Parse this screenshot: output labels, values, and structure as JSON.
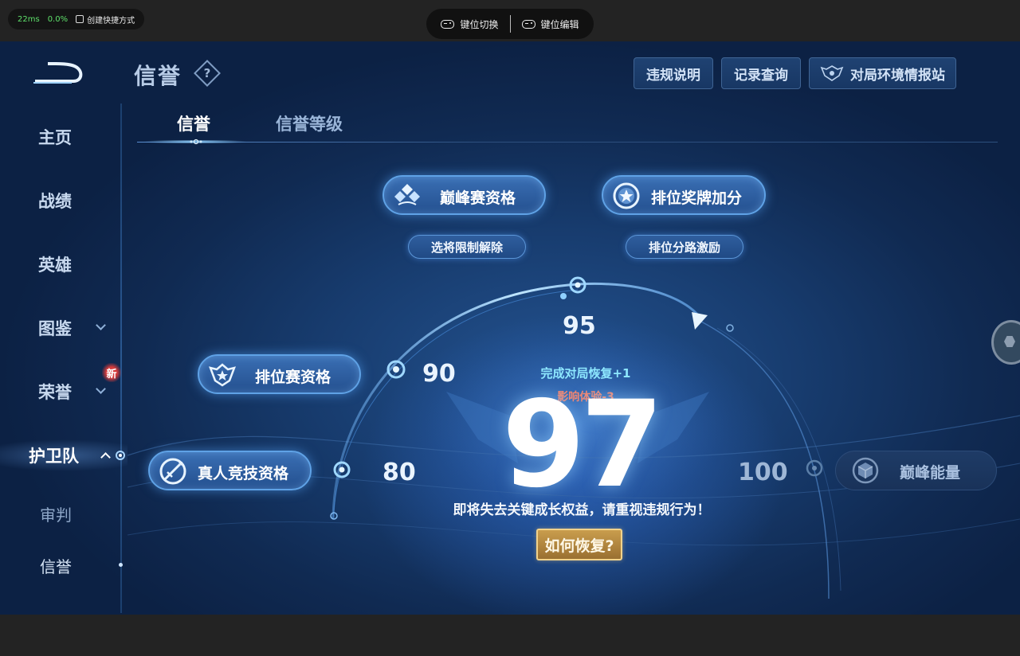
{
  "topbar": {
    "latency": "22ms",
    "loss": "0.0%",
    "shortcut_label": "创建快捷方式",
    "key_switch_label": "键位切换",
    "key_edit_label": "键位编辑"
  },
  "sidebar": {
    "items": [
      {
        "label": "主页"
      },
      {
        "label": "战绩"
      },
      {
        "label": "英雄"
      },
      {
        "label": "图鉴"
      },
      {
        "label": "荣誉"
      },
      {
        "label": "护卫队"
      }
    ],
    "new_badge": "新",
    "sub_items": [
      {
        "label": "审判"
      },
      {
        "label": "信誉"
      }
    ]
  },
  "header": {
    "title": "信誉",
    "help_glyph": "?",
    "buttons": {
      "violation": "违规说明",
      "records": "记录查询",
      "environment": "对局环境情报站"
    }
  },
  "tabs": [
    {
      "label": "信誉",
      "active": true
    },
    {
      "label": "信誉等级",
      "active": false
    }
  ],
  "rewards": {
    "peak_qualification": "巅峰赛资格",
    "peak_sub": "选将限制解除",
    "rank_medal": "排位奖牌加分",
    "rank_medal_sub": "排位分路激励",
    "rank_qualification": "排位赛资格",
    "real_person": "真人竞技资格",
    "peak_energy": "巅峰能量"
  },
  "thresholds": {
    "t80": "80",
    "t90": "90",
    "t95": "95",
    "t100": "100"
  },
  "score": {
    "value": "97",
    "recover_hint": "完成对局恢复+1",
    "impact_hint": "影响体验-3",
    "warning": "即将失去关键成长权益，请重视违规行为！",
    "recover_button": "如何恢复?"
  },
  "colors": {
    "accent_blue": "#5fa2e6",
    "recover_cyan": "#8ee8ff",
    "impact_red": "#f2856f",
    "gold_button": "#c99d4d"
  }
}
